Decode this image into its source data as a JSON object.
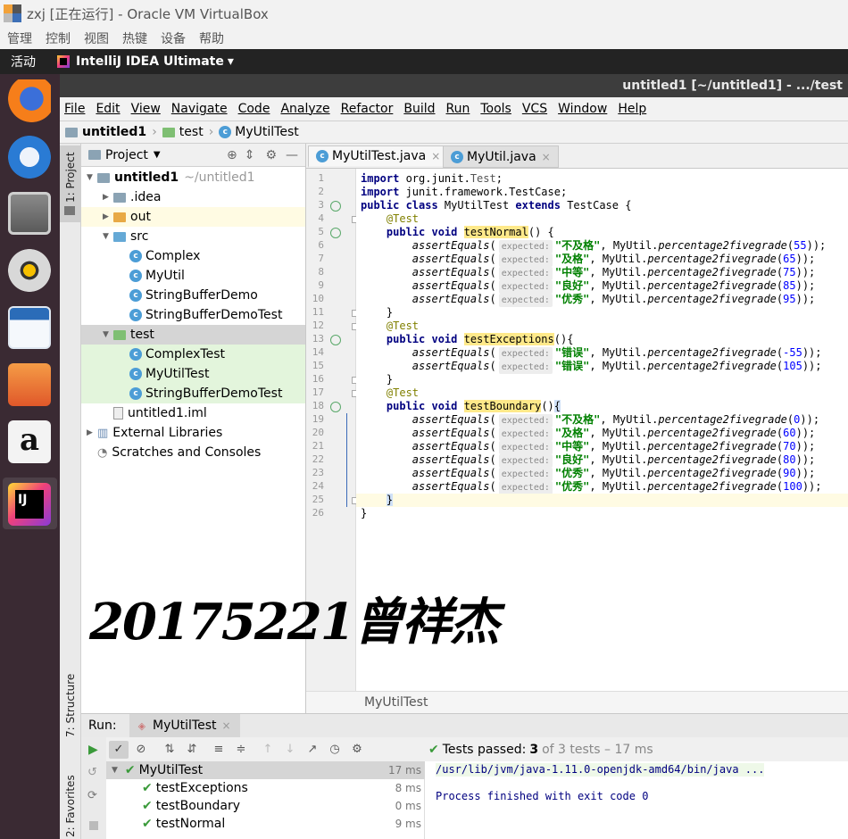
{
  "window": {
    "title": "zxj [正在运行] - Oracle VM VirtualBox",
    "menu": [
      "管理",
      "控制",
      "视图",
      "热键",
      "设备",
      "帮助"
    ]
  },
  "topbar": {
    "activities": "活动",
    "app_name": "IntelliJ IDEA Ultimate",
    "app_arrow": "▾"
  },
  "dock": {
    "apps": [
      "firefox-icon",
      "thunderbird-icon",
      "files-icon",
      "rhythmbox-icon",
      "writer-icon",
      "software-center-icon",
      "amazon-icon",
      "intellij-icon"
    ]
  },
  "ide": {
    "title": "untitled1 [~/untitled1] - .../test",
    "menu": [
      "File",
      "Edit",
      "View",
      "Navigate",
      "Code",
      "Analyze",
      "Refactor",
      "Build",
      "Run",
      "Tools",
      "VCS",
      "Window",
      "Help"
    ],
    "breadcrumb": [
      "untitled1",
      "test",
      "MyUtilTest"
    ],
    "left_strip": {
      "project": "1: Project",
      "structure": "7: Structure",
      "favorites": "2: Favorites"
    }
  },
  "project": {
    "header": "Project",
    "tree": [
      {
        "label": "untitled1",
        "extra": "~/untitled1",
        "indent": 0,
        "arrow": "▼",
        "icon": "module",
        "bold": true
      },
      {
        "label": ".idea",
        "indent": 1,
        "arrow": "▶",
        "icon": "folder"
      },
      {
        "label": "out",
        "indent": 1,
        "arrow": "▶",
        "icon": "folder-orange"
      },
      {
        "label": "src",
        "indent": 1,
        "arrow": "▼",
        "icon": "folder-blue"
      },
      {
        "label": "Complex",
        "indent": 2,
        "icon": "class"
      },
      {
        "label": "MyUtil",
        "indent": 2,
        "icon": "class"
      },
      {
        "label": "StringBufferDemo",
        "indent": 2,
        "icon": "class"
      },
      {
        "label": "StringBufferDemoTest",
        "indent": 2,
        "icon": "class"
      },
      {
        "label": "test",
        "indent": 1,
        "arrow": "▼",
        "icon": "folder-green"
      },
      {
        "label": "ComplexTest",
        "indent": 2,
        "icon": "class"
      },
      {
        "label": "MyUtilTest",
        "indent": 2,
        "icon": "class"
      },
      {
        "label": "StringBufferDemoTest",
        "indent": 2,
        "icon": "class"
      },
      {
        "label": "untitled1.iml",
        "indent": 1,
        "icon": "file"
      },
      {
        "label": "External Libraries",
        "indent": 0,
        "arrow": "▶",
        "icon": "library"
      },
      {
        "label": "Scratches and Consoles",
        "indent": 0,
        "icon": "scratch"
      }
    ]
  },
  "editor": {
    "tabs": [
      "MyUtilTest.java",
      "MyUtil.java"
    ],
    "file_crumb": "MyUtilTest",
    "hint": "expected:",
    "lines": [
      {
        "n": "1",
        "code": [
          [
            "kw",
            "import "
          ],
          [
            "",
            "org.junit."
          ],
          [
            "ann2",
            "Test"
          ],
          [
            "",
            ";"
          ]
        ]
      },
      {
        "n": "2",
        "code": [
          [
            "kw",
            "import "
          ],
          [
            "",
            "junit.framework.TestCase;"
          ]
        ]
      },
      {
        "n": "3",
        "code": [
          [
            "kw",
            "public class "
          ],
          [
            "",
            "MyUtilTest "
          ],
          [
            "kw",
            "extends "
          ],
          [
            "",
            "TestCase {"
          ]
        ]
      },
      {
        "n": "4",
        "code": [
          [
            "",
            "    "
          ],
          [
            "ann",
            "@Test"
          ]
        ]
      },
      {
        "n": "5",
        "code": [
          [
            "",
            "    "
          ],
          [
            "kw",
            "public void "
          ],
          [
            "method",
            "testNormal"
          ],
          [
            "",
            "() {"
          ]
        ]
      },
      {
        "n": "6",
        "assert": [
          "\"不及格\"",
          "55"
        ]
      },
      {
        "n": "7",
        "assert": [
          "\"及格\"",
          "65"
        ]
      },
      {
        "n": "8",
        "assert": [
          "\"中等\"",
          "75"
        ]
      },
      {
        "n": "9",
        "assert": [
          "\"良好\"",
          "85"
        ]
      },
      {
        "n": "10",
        "assert": [
          "\"优秀\"",
          "95"
        ]
      },
      {
        "n": "11",
        "code": [
          [
            "",
            "    }"
          ]
        ]
      },
      {
        "n": "12",
        "code": [
          [
            "",
            "    "
          ],
          [
            "ann",
            "@Test"
          ]
        ]
      },
      {
        "n": "13",
        "code": [
          [
            "",
            "    "
          ],
          [
            "kw",
            "public void "
          ],
          [
            "method",
            "testExceptions"
          ],
          [
            "",
            "(){"
          ]
        ]
      },
      {
        "n": "14",
        "assert": [
          "\"错误\"",
          "-55"
        ]
      },
      {
        "n": "15",
        "assert": [
          "\"错误\"",
          "105"
        ]
      },
      {
        "n": "16",
        "code": [
          [
            "",
            "    }"
          ]
        ]
      },
      {
        "n": "17",
        "code": [
          [
            "",
            "    "
          ],
          [
            "ann",
            "@Test"
          ]
        ]
      },
      {
        "n": "18",
        "code": [
          [
            "",
            "    "
          ],
          [
            "kw",
            "public void "
          ],
          [
            "method",
            "testBoundary"
          ],
          [
            "",
            "()"
          ],
          [
            "brace",
            "{"
          ]
        ]
      },
      {
        "n": "19",
        "assert": [
          "\"不及格\"",
          "0"
        ]
      },
      {
        "n": "20",
        "assert": [
          "\"及格\"",
          "60"
        ]
      },
      {
        "n": "21",
        "assert": [
          "\"中等\"",
          "70"
        ]
      },
      {
        "n": "22",
        "assert": [
          "\"良好\"",
          "80"
        ]
      },
      {
        "n": "23",
        "assert": [
          "\"优秀\"",
          "90"
        ]
      },
      {
        "n": "24",
        "assert": [
          "\"优秀\"",
          "100"
        ]
      },
      {
        "n": "25",
        "code": [
          [
            "",
            "    "
          ],
          [
            "brace",
            "}"
          ]
        ]
      },
      {
        "n": "26",
        "code": [
          [
            "",
            "}"
          ]
        ]
      }
    ]
  },
  "watermark": "20175221曾祥杰",
  "run": {
    "label": "Run:",
    "tab": "MyUtilTest",
    "status_prefix": "Tests passed:",
    "status_count": "3",
    "status_suffix": "of 3 tests – 17 ms",
    "tests": [
      {
        "name": "MyUtilTest",
        "time": "17 ms",
        "root": true
      },
      {
        "name": "testExceptions",
        "time": "8 ms"
      },
      {
        "name": "testBoundary",
        "time": "0 ms"
      },
      {
        "name": "testNormal",
        "time": "9 ms"
      }
    ],
    "console": [
      "/usr/lib/jvm/java-1.11.0-openjdk-amd64/bin/java ...",
      "",
      "Process finished with exit code 0"
    ]
  }
}
